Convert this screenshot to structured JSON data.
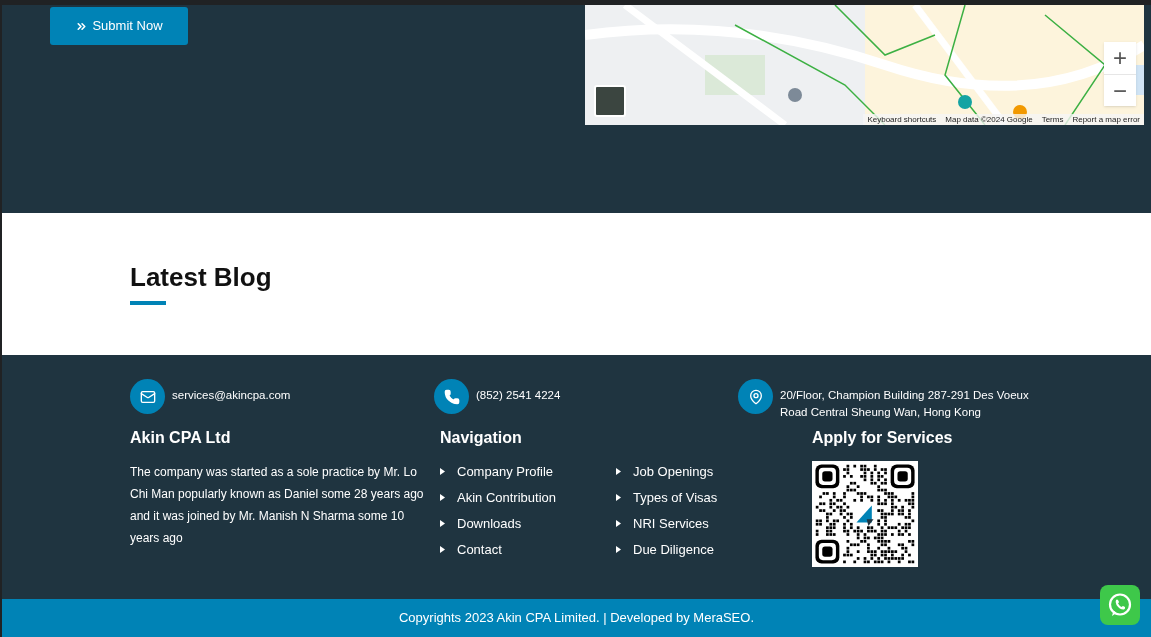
{
  "form": {
    "submit_button": "Submit Now"
  },
  "map": {
    "zoom_in": "+",
    "zoom_out": "−",
    "attribution": [
      "Keyboard shortcuts",
      "Map data ©2024 Google",
      "Terms",
      "Report a map error"
    ]
  },
  "blog": {
    "title": "Latest Blog"
  },
  "contacts": [
    {
      "kind": "email",
      "text": "services@akincpa.com"
    },
    {
      "kind": "phone",
      "text": "(852) 2541 4224"
    },
    {
      "kind": "location",
      "text": "20/Floor, Champion Building 287-291 Des Voeux Road Central Sheung Wan, Hong Kong"
    }
  ],
  "about": {
    "title": "Akin CPA Ltd",
    "text": "The company was started as a sole practice by Mr. Lo Chi Man popularly known as Daniel some 28 years ago and it was joined by Mr. Manish N Sharma some 10 years ago"
  },
  "navigation": {
    "title": "Navigation",
    "columns": [
      [
        "Company Profile",
        "Akin Contribution",
        "Downloads",
        "Contact"
      ],
      [
        "Job Openings",
        "Types of Visas",
        "NRI Services",
        "Due Diligence"
      ]
    ]
  },
  "services": {
    "title": "Apply for Services"
  },
  "copyright": "Copyrights 2023 Akin CPA Limited. | Developed by MeraSEO."
}
